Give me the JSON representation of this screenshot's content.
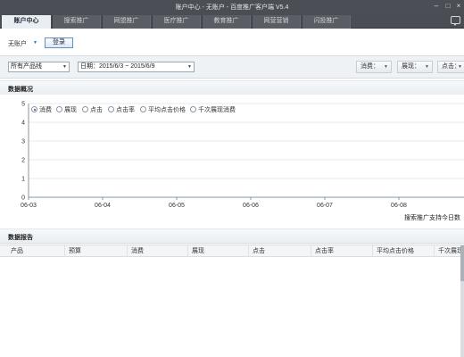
{
  "window": {
    "title": "账户中心 - 无账户 - 百度推广客户端 V5.4"
  },
  "tabs": [
    {
      "label": "账户中心",
      "active": true
    },
    {
      "label": "搜索推广",
      "active": false
    },
    {
      "label": "网盟推广",
      "active": false
    },
    {
      "label": "医疗推广",
      "active": false
    },
    {
      "label": "教育推广",
      "active": false
    },
    {
      "label": "网营营销",
      "active": false
    },
    {
      "label": "闪投推广",
      "active": false
    }
  ],
  "account": {
    "name": "无账户",
    "login_label": "登录"
  },
  "filters": {
    "product_line": "所有产品线",
    "date_range": "日期：2015/6/3 ~ 2015/6/9",
    "metric_buttons": [
      "消费：",
      "展现：",
      "点击："
    ]
  },
  "overview": {
    "title": "数据概况",
    "legend": [
      {
        "label": "消费",
        "selected": true
      },
      {
        "label": "展现",
        "selected": false
      },
      {
        "label": "点击",
        "selected": false
      },
      {
        "label": "点击率",
        "selected": false
      },
      {
        "label": "平均点击价格",
        "selected": false
      },
      {
        "label": "千次展现消费",
        "selected": false
      }
    ],
    "note": "搜索推广支持今日数"
  },
  "chart_data": {
    "type": "line",
    "x": [
      "06-03",
      "06-04",
      "06-05",
      "06-06",
      "06-07",
      "06-08"
    ],
    "ylim": [
      0,
      5
    ],
    "yticks": [
      "0",
      "1",
      "2",
      "3",
      "4",
      "5"
    ],
    "series": [],
    "grid": true
  },
  "report": {
    "title": "数据报告",
    "columns": [
      "产品",
      "预算",
      "消费",
      "展现",
      "点击",
      "点击率",
      "平均点击价格",
      "千次展现消费"
    ]
  },
  "colors": {
    "titlebar": "#4b4f55",
    "tab_active": "#e9eef3",
    "accent": "#2c6ebc"
  }
}
